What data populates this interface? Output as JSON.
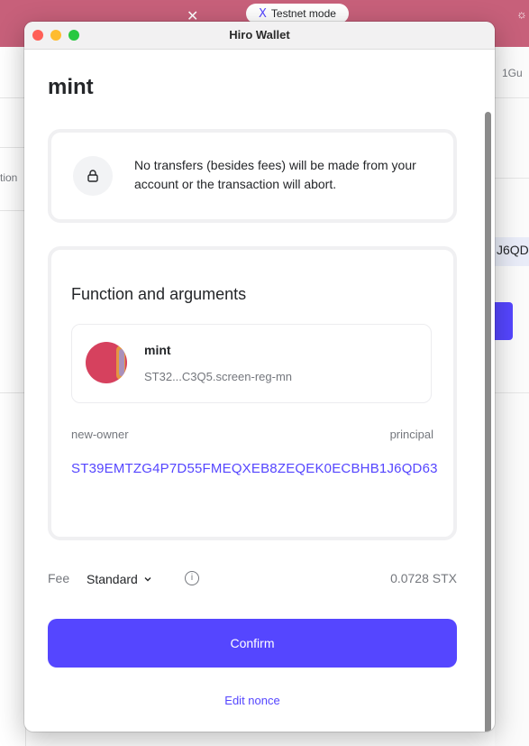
{
  "background": {
    "testnet_badge": "Testnet mode",
    "tab_close_glyph": "✕",
    "right_truncated": "1Gu",
    "right_value": "J6QD",
    "left_truncated": "tion"
  },
  "window": {
    "title": "Hiro Wallet"
  },
  "page": {
    "title": "mint"
  },
  "postcondition": {
    "icon": "lock-icon",
    "text": "No transfers (besides fees) will be made from your account or the transaction will abort."
  },
  "function_card": {
    "heading": "Function and arguments",
    "contract": {
      "name": "mint",
      "id": "ST32...C3Q5.screen-reg-mn"
    },
    "argument": {
      "name": "new-owner",
      "type": "principal",
      "value": "ST39EMTZG4P7D55FMEQXEB8ZEQEK0ECBHB1J6QD63"
    }
  },
  "fee": {
    "label": "Fee",
    "selected": "Standard",
    "amount": "0.0728 STX"
  },
  "actions": {
    "confirm": "Confirm",
    "edit_nonce": "Edit nonce"
  },
  "colors": {
    "accent": "#5546ff",
    "topbar": "#c7607a"
  }
}
